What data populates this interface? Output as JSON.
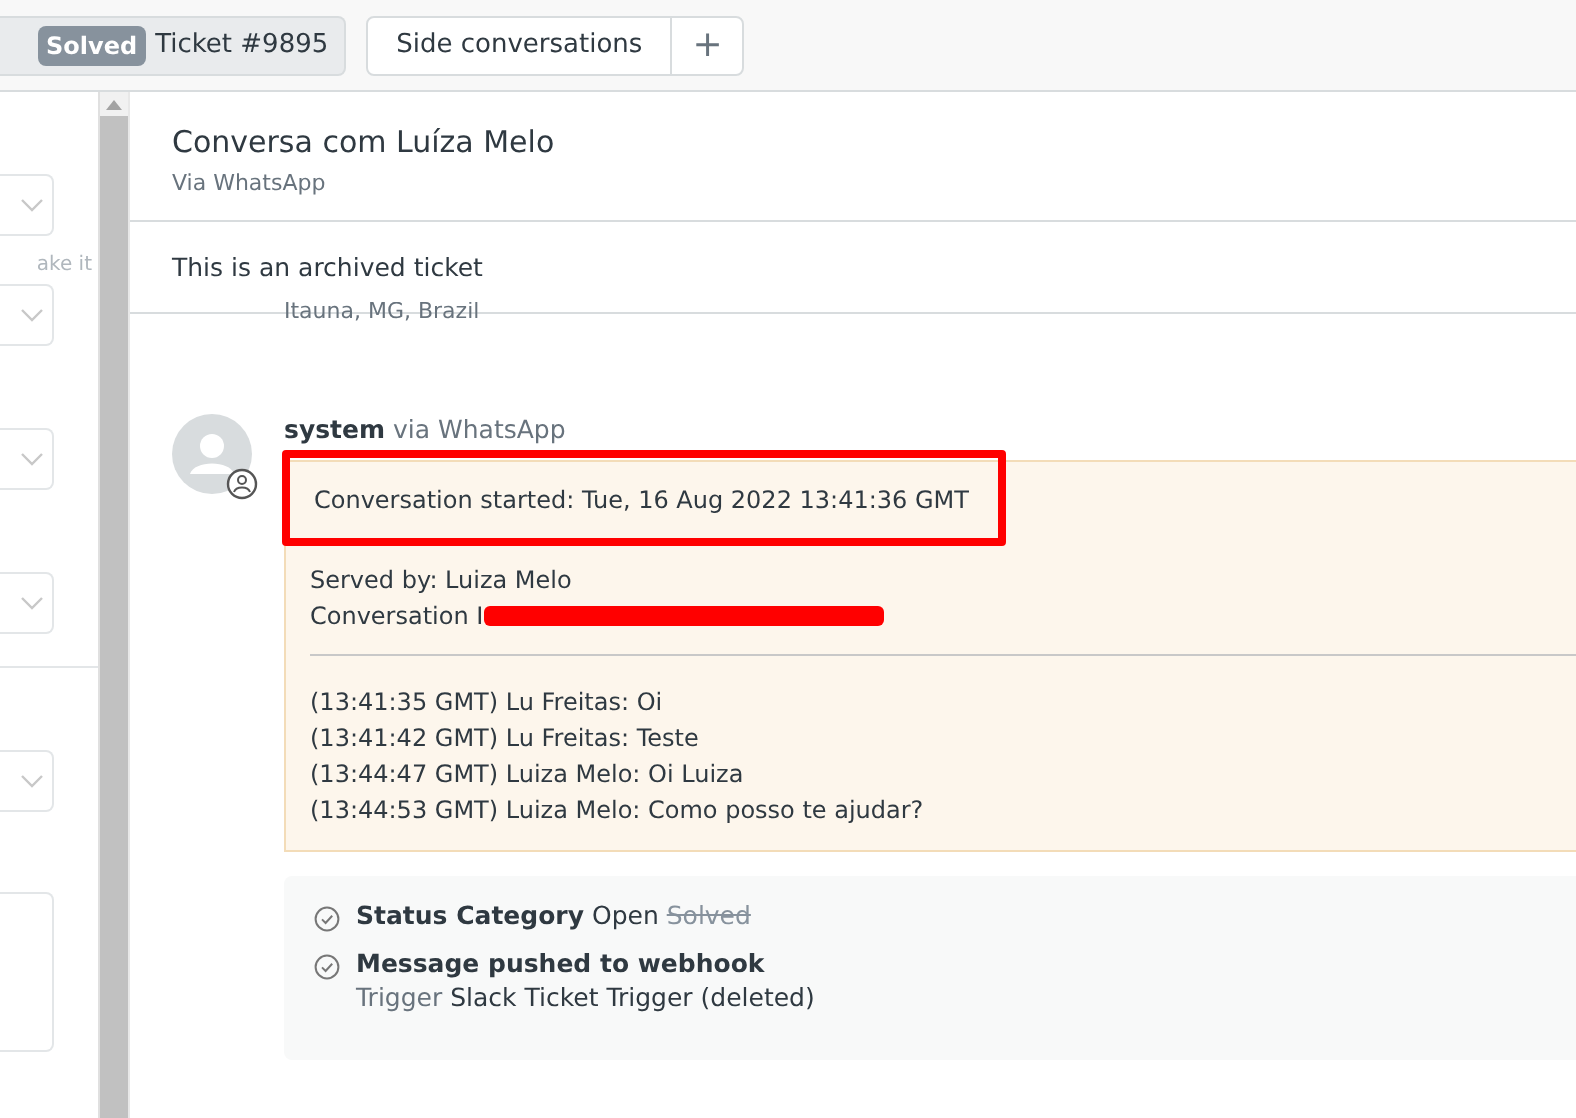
{
  "top_bar": {
    "ticket_tab": {
      "status": "Solved",
      "label": "Ticket #9895"
    },
    "side_conversations": "Side conversations",
    "add_button": "+"
  },
  "sidebar": {
    "cut_hint": "ake it"
  },
  "conversation": {
    "title": "Conversa com Luíza Melo",
    "channel": "Via WhatsApp",
    "archived_notice": "This is an archived ticket",
    "location": "Itauna, MG, Brazil",
    "message": {
      "author": "system",
      "via": "via WhatsApp",
      "started": "Conversation started: Tue, 16 Aug 2022 13:41:36 GMT",
      "served_by": "Served by: Luiza Melo",
      "conversation_id": "Conversation I",
      "lines": [
        "(13:41:35 GMT) Lu Freitas: Oi",
        "(13:41:42 GMT) Lu Freitas: Teste",
        "(13:44:47 GMT) Luiza Melo: Oi Luiza",
        "(13:44:53 GMT) Luiza Melo: Como posso te ajudar?"
      ]
    },
    "events": [
      {
        "kind": "change",
        "title": "Status Category",
        "new_value": "Open",
        "old_value": "Solved"
      },
      {
        "kind": "trigger",
        "title": "Message pushed to webhook",
        "label": "Trigger",
        "detail": "Slack Ticket Trigger (deleted)"
      }
    ]
  }
}
